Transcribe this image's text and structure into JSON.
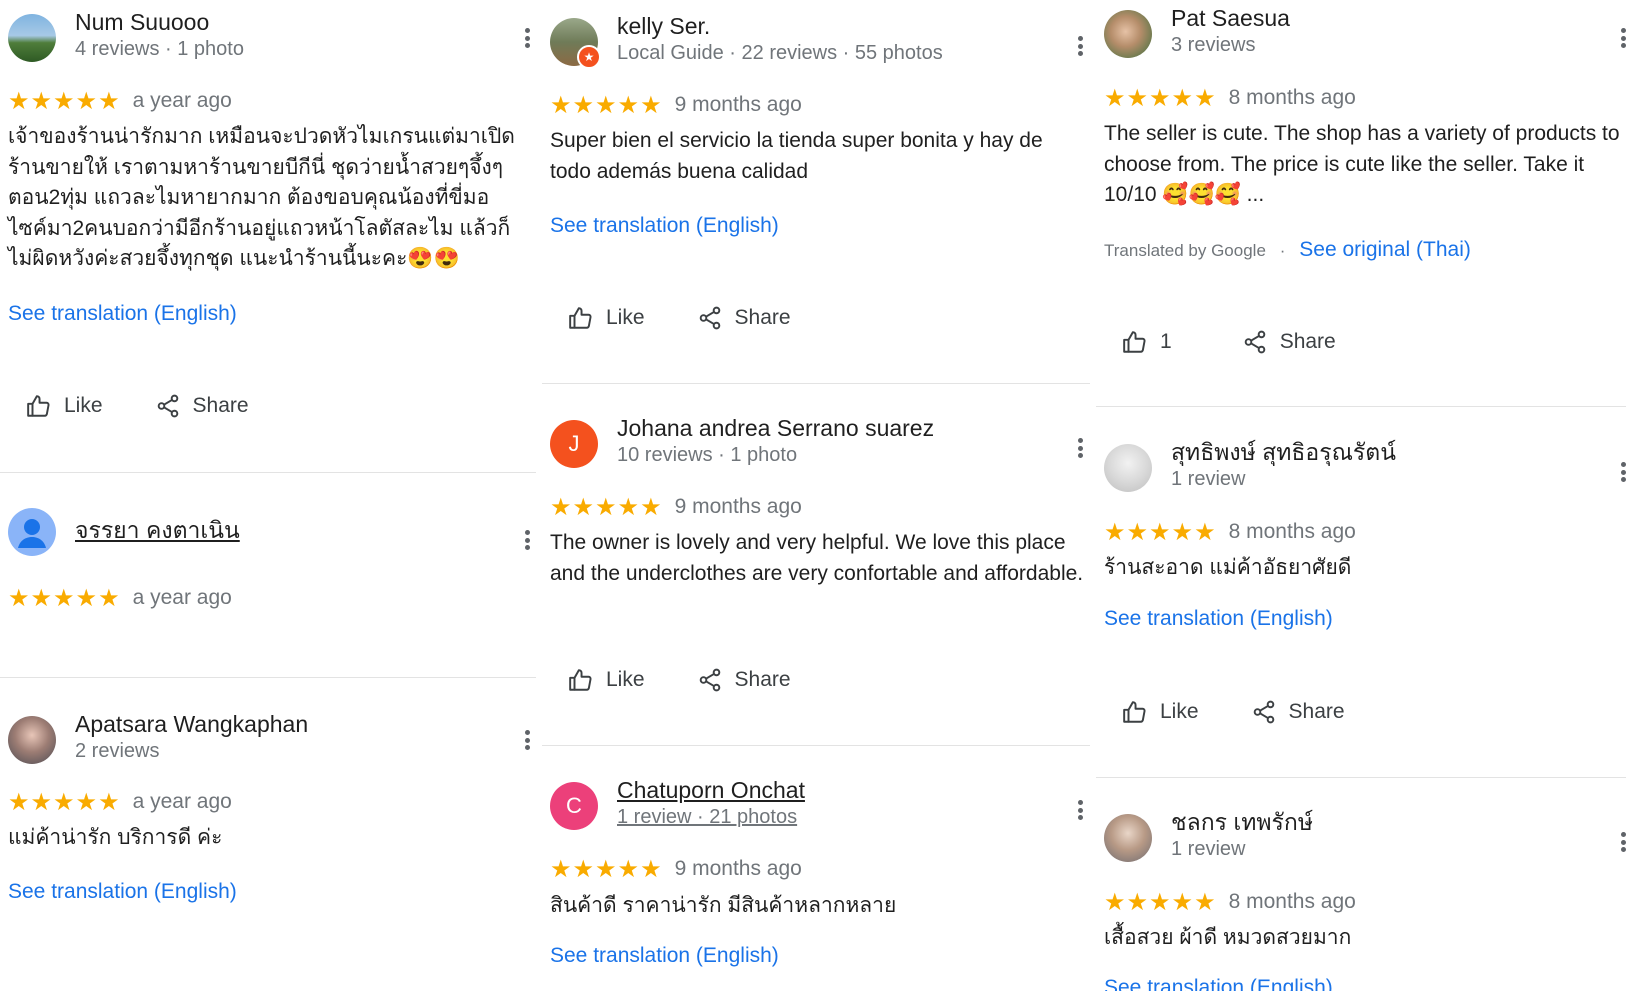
{
  "common": {
    "like": "Like",
    "share": "Share",
    "see_translation": "See translation (English)",
    "star_glyphs": "★★★★★"
  },
  "col1": {
    "r1": {
      "name": "Num Suuooo",
      "meta": "4 reviews · 1 photo",
      "rating": 5,
      "when": "a year ago",
      "text": "เจ้าของร้านน่ารักมาก เหมือนจะปวดหัวไมเกรนแต่มาเปิดร้านขายให้ เราตามหาร้านขายบีกีนี่ ชุดว่ายน้ำสวยๆจึ้งๆตอน2ทุ่ม แถวละไมหายากมาก ต้องขอบคุณน้องที่ขี่มอไซค์มา2คนบอกว่ามีอีกร้านอยู่แถวหน้าโลตัสละไม แล้วก็ไม่ผิดหวังค่ะสวยจึ้งทุกชุด แนะนำร้านนี้นะคะ😍😍"
    },
    "r2": {
      "name": "จรรยา คงตาเนิน",
      "rating": 5,
      "when": "a year ago"
    },
    "r3": {
      "name": "Apatsara Wangkaphan",
      "meta": "2 reviews",
      "rating": 5,
      "when": "a year ago",
      "text": "แม่ค้าน่ารัก บริการดี ค่ะ"
    }
  },
  "col2": {
    "r1": {
      "name": "kelly Ser.",
      "meta": "Local Guide · 22 reviews · 55 photos",
      "rating": 5,
      "when": "9 months ago",
      "text": "Super bien el servicio la tienda super bonita y hay de todo además buena calidad"
    },
    "r2": {
      "name": "Johana andrea Serrano suarez",
      "initial": "J",
      "meta": "10 reviews · 1 photo",
      "rating": 5,
      "when": "9 months ago",
      "text": "The owner is lovely and very helpful. We love this place and the underclothes are very confortable and affordable."
    },
    "r3": {
      "name": "Chatuporn Onchat",
      "initial": "C",
      "meta": "1 review · 21 photos",
      "rating": 5,
      "when": "9 months ago",
      "text": "สินค้าดี ราคาน่ารัก มีสินค้าหลากหลาย"
    }
  },
  "col3": {
    "r1": {
      "name": "Pat Saesua",
      "meta": "3 reviews",
      "rating": 5,
      "when": "8 months ago",
      "text": "The seller is cute. The shop has a variety of products to choose from. The price is cute like the seller. Take it 10/10 🥰🥰🥰 ...",
      "translated_by": "Translated by Google",
      "see_original": "See original (Thai)",
      "like_count": "1"
    },
    "r2": {
      "name": "สุทธิพงษ์ สุทธิอรุณรัตน์",
      "meta": "1 review",
      "rating": 5,
      "when": "8 months ago",
      "text": "ร้านสะอาด แม่ค้าอัธยาศัยดี"
    },
    "r3": {
      "name": "ชลกร เทพรักษ์",
      "meta": "1 review",
      "rating": 5,
      "when": "8 months ago",
      "text": "เสื้อสวย ผ้าดี หมวดสวยมาก"
    }
  },
  "colors": {
    "star": "#f9ab00",
    "link": "#1a73e8",
    "avatar_j": "#f4511e",
    "avatar_c": "#ec407a",
    "avatar_default": "#8ab4f8"
  },
  "icons": [
    "more-vert-icon",
    "thumb-up-icon",
    "share-icon",
    "star-icon"
  ]
}
